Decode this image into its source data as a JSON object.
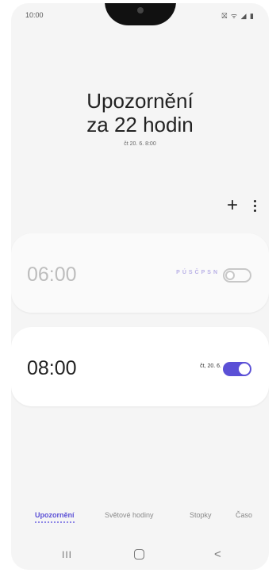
{
  "status_bar": {
    "time": "10:00",
    "icons": "⛝ ᯤ ◢ ▮"
  },
  "header": {
    "title_line1": "Upozornění",
    "title_line2": "za 22 hodin",
    "subtitle": "čt 20. 6. 8:00"
  },
  "toolbar": {
    "add_label": "+"
  },
  "alarms": [
    {
      "time": "06:00",
      "days": "PÚSČPSN",
      "enabled": false
    },
    {
      "time": "08:00",
      "date": "čt, 20. 6.",
      "enabled": true
    }
  ],
  "tabs": [
    {
      "label": "Upozornění",
      "active": true
    },
    {
      "label": "Světové hodiny"
    },
    {
      "label": "Stopky"
    },
    {
      "label": "Časo"
    }
  ],
  "navbar": {
    "recent": "III",
    "back": "<"
  },
  "colors": {
    "accent": "#5b50d6",
    "background": "#f5f5f5"
  }
}
